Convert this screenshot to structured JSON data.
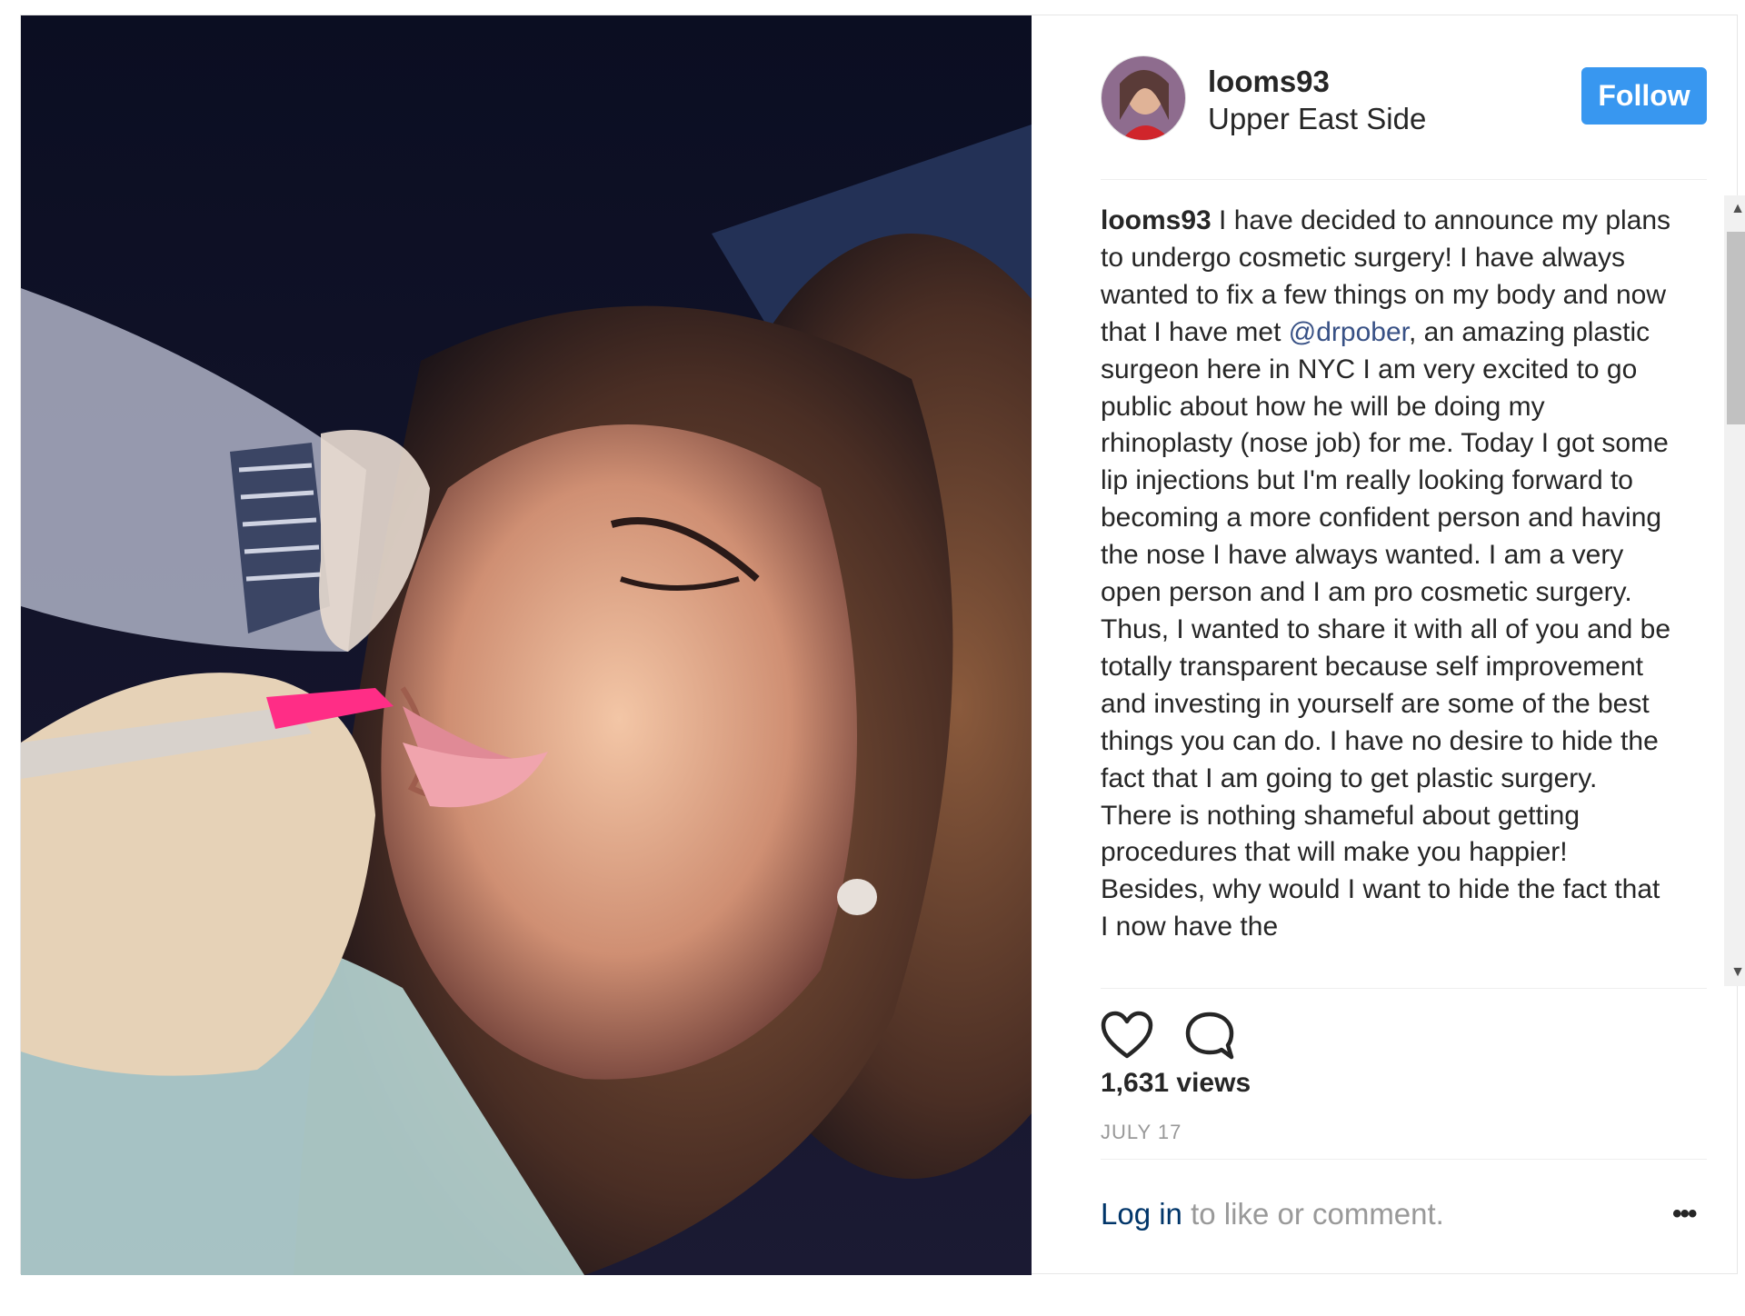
{
  "post": {
    "username": "looms93",
    "location": "Upper East Side",
    "follow_label": "Follow",
    "caption_username": "looms93",
    "caption_part1": " I have decided to announce my plans to undergo cosmetic surgery! I have always wanted to fix a few things on my body and now that I have met ",
    "caption_mention": "@drpober",
    "caption_part2": ", an amazing plastic surgeon here in NYC I am very excited to go public about how he will be doing my rhinoplasty (nose job) for me. Today I got some lip injections but I'm really looking forward to becoming a more confident person and having the nose I have always wanted. I am a very open person and I am pro cosmetic surgery. Thus, I wanted to share it with all of you and be totally transparent because self improvement and investing in yourself are some of the best things you can do. I have no desire to hide the fact that I am going to get plastic surgery. There is nothing shameful about getting procedures that will make you happier! Besides, why would I want to hide the fact that I now have the",
    "views": "1,631 views",
    "date": "JULY 17",
    "login_label": "Log in",
    "login_suffix": " to like or comment.",
    "more_label": "•••"
  },
  "icons": {
    "like": "heart-icon",
    "comment": "comment-icon",
    "more": "more-options-icon"
  },
  "colors": {
    "follow_bg": "#3897f0",
    "mention": "#385185",
    "muted": "#999999"
  }
}
